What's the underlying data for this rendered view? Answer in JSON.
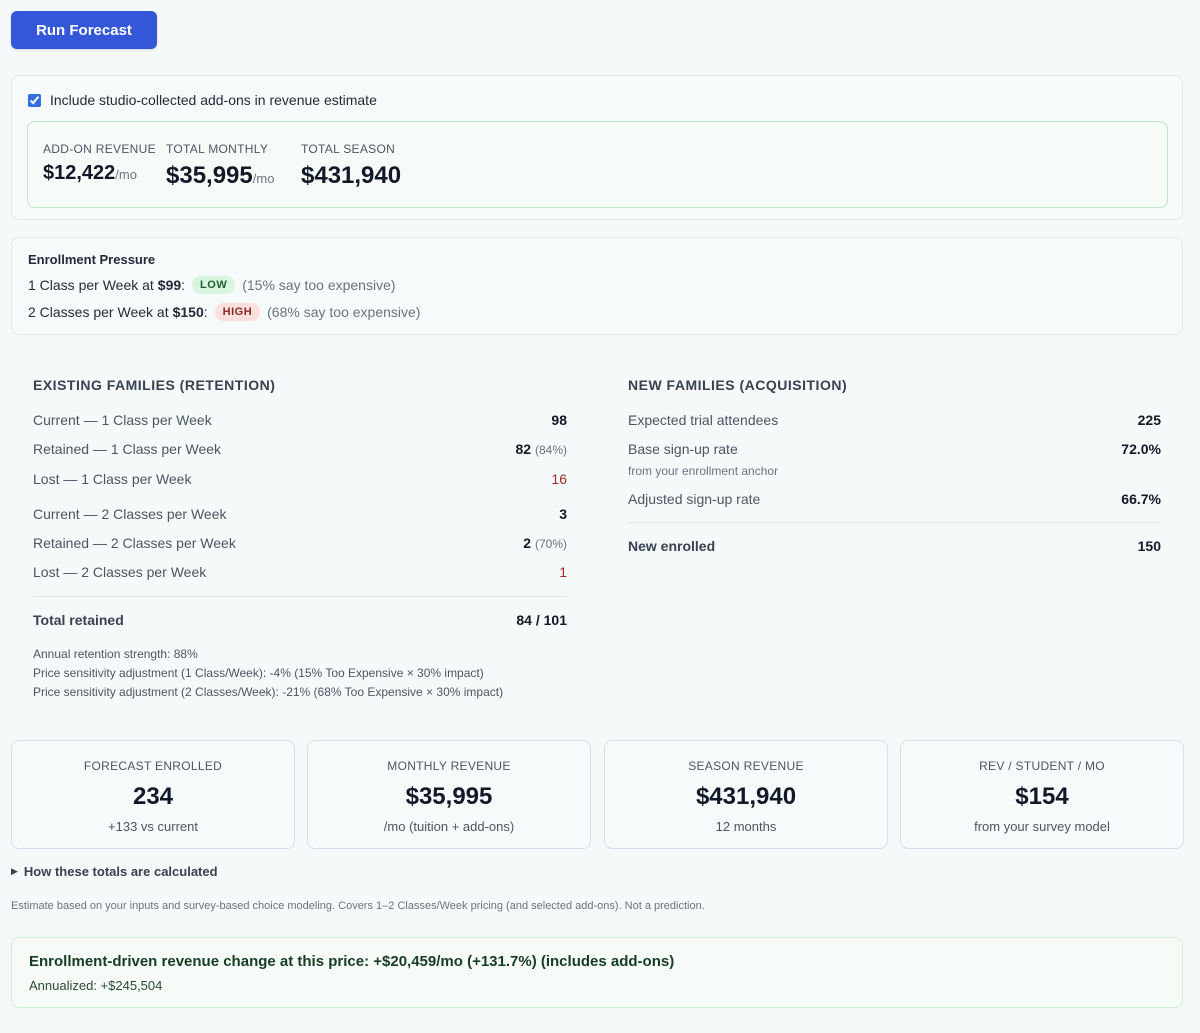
{
  "toolbar": {
    "run_label": "Run Forecast"
  },
  "addons": {
    "checkbox_label": "Include studio-collected add-ons in revenue estimate",
    "checked": true,
    "stats": [
      {
        "label": "ADD-ON REVENUE",
        "value": "$12,422",
        "unit": "/mo"
      },
      {
        "label": "TOTAL MONTHLY",
        "value": "$35,995",
        "unit": "/mo"
      },
      {
        "label": "TOTAL SEASON",
        "value": "$431,940",
        "unit": ""
      }
    ]
  },
  "pressure": {
    "title": "Enrollment Pressure",
    "rows": [
      {
        "plan": "1 Class per Week at",
        "price": "$99",
        "colon": ":",
        "level": "LOW",
        "note": "(15% say too expensive)"
      },
      {
        "plan": "2 Classes per Week at",
        "price": "$150",
        "colon": ":",
        "level": "HIGH",
        "note": "(68% say too expensive)"
      }
    ]
  },
  "retention": {
    "title": "EXISTING FAMILIES (RETENTION)",
    "rows": [
      {
        "label": "Current — 1 Class per Week",
        "value": "98",
        "pct": ""
      },
      {
        "label": "Retained — 1 Class per Week",
        "value": "82",
        "pct": "(84%)"
      },
      {
        "label": "Lost — 1 Class per Week",
        "value": "16",
        "pct": ""
      },
      {
        "label": "Current — 2 Classes per Week",
        "value": "3",
        "pct": ""
      },
      {
        "label": "Retained — 2 Classes per Week",
        "value": "2",
        "pct": "(70%)"
      },
      {
        "label": "Lost — 2 Classes per Week",
        "value": "1",
        "pct": ""
      }
    ],
    "total_label": "Total retained",
    "total_value": "84 / 101",
    "notes": [
      "Annual retention strength: 88%",
      "Price sensitivity adjustment (1 Class/Week): -4% (15% Too Expensive × 30% impact)",
      "Price sensitivity adjustment (2 Classes/Week): -21% (68% Too Expensive × 30% impact)"
    ]
  },
  "acquisition": {
    "title": "NEW FAMILIES (ACQUISITION)",
    "rows": [
      {
        "label": "Expected trial attendees",
        "value": "225"
      },
      {
        "label": "Base sign-up rate",
        "value": "72.0%",
        "sub": "from your enrollment anchor"
      },
      {
        "label": "Adjusted sign-up rate",
        "value": "66.7%"
      }
    ],
    "total_label": "New enrolled",
    "total_value": "150"
  },
  "kpis": [
    {
      "label": "FORECAST ENROLLED",
      "value": "234",
      "sub": "+133 vs current"
    },
    {
      "label": "MONTHLY REVENUE",
      "value": "$35,995",
      "sub": "/mo (tuition + add-ons)"
    },
    {
      "label": "SEASON REVENUE",
      "value": "$431,940",
      "sub": "12 months"
    },
    {
      "label": "REV / STUDENT / MO",
      "value": "$154",
      "sub": "from your survey model"
    }
  ],
  "details_label": "How these totals are calculated",
  "disclaimer": "Estimate based on your inputs and survey-based choice modeling. Covers 1–2 Classes/Week pricing (and selected add-ons). Not a prediction.",
  "change": {
    "title": "Enrollment-driven revenue change at this price: +$20,459/mo (+131.7%) (includes add-ons)",
    "annualized": "Annualized: +$245,504"
  },
  "colors": {
    "accent": "#3457d9",
    "low": "#d8f5df",
    "high": "#fbe0de",
    "lost": "#a12b2b"
  }
}
